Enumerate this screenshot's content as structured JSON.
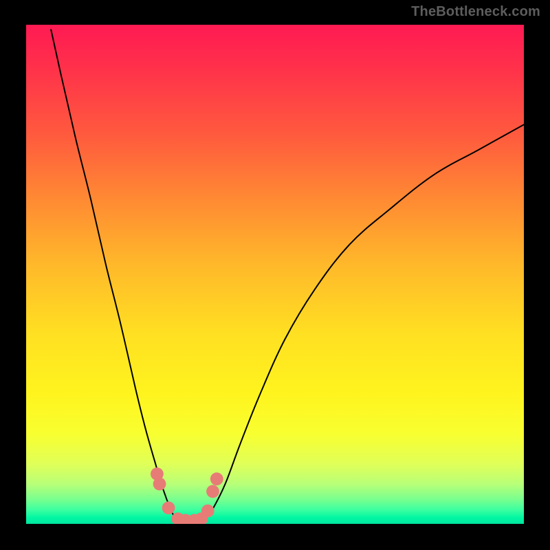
{
  "watermark": "TheBottleneck.com",
  "chart_data": {
    "type": "line",
    "title": "",
    "xlabel": "",
    "ylabel": "",
    "xlim": [
      0,
      100
    ],
    "ylim": [
      0,
      100
    ],
    "grid": false,
    "legend": false,
    "background": {
      "style": "vertical-gradient",
      "stops": [
        {
          "pct": 0,
          "color": "#ff1a53"
        },
        {
          "pct": 35,
          "color": "#ff8a33"
        },
        {
          "pct": 62,
          "color": "#ffe022"
        },
        {
          "pct": 88,
          "color": "#e0ff58"
        },
        {
          "pct": 100,
          "color": "#00e49e"
        }
      ]
    },
    "series": [
      {
        "name": "left-branch",
        "x": [
          5.0,
          7.0,
          10.0,
          13.0,
          16.0,
          19.0,
          22.0,
          24.0,
          26.0,
          27.5,
          29.0,
          30.0
        ],
        "y": [
          99.0,
          90.0,
          77.0,
          65.0,
          52.0,
          40.0,
          27.0,
          19.0,
          12.0,
          7.0,
          3.0,
          1.0
        ]
      },
      {
        "name": "right-branch",
        "x": [
          36.0,
          37.5,
          40.0,
          43.0,
          47.0,
          52.0,
          58.0,
          65.0,
          73.0,
          82.0,
          91.0,
          100.0
        ],
        "y": [
          1.0,
          3.0,
          8.0,
          16.0,
          26.0,
          37.0,
          47.0,
          56.0,
          63.0,
          70.0,
          75.0,
          80.0
        ]
      },
      {
        "name": "trough",
        "x": [
          30.0,
          31.5,
          33.0,
          34.5,
          36.0
        ],
        "y": [
          1.0,
          0.3,
          0.2,
          0.3,
          1.0
        ]
      }
    ],
    "markers": [
      {
        "x": 26.3,
        "y": 10.0,
        "r": 1.3
      },
      {
        "x": 26.8,
        "y": 8.0,
        "r": 1.3
      },
      {
        "x": 28.6,
        "y": 3.2,
        "r": 1.3
      },
      {
        "x": 30.5,
        "y": 1.0,
        "r": 1.3
      },
      {
        "x": 32.0,
        "y": 0.7,
        "r": 1.3
      },
      {
        "x": 33.8,
        "y": 0.7,
        "r": 1.3
      },
      {
        "x": 35.2,
        "y": 1.0,
        "r": 1.3
      },
      {
        "x": 36.5,
        "y": 2.6,
        "r": 1.3
      },
      {
        "x": 37.5,
        "y": 6.5,
        "r": 1.3
      },
      {
        "x": 38.3,
        "y": 9.0,
        "r": 1.3
      }
    ]
  }
}
